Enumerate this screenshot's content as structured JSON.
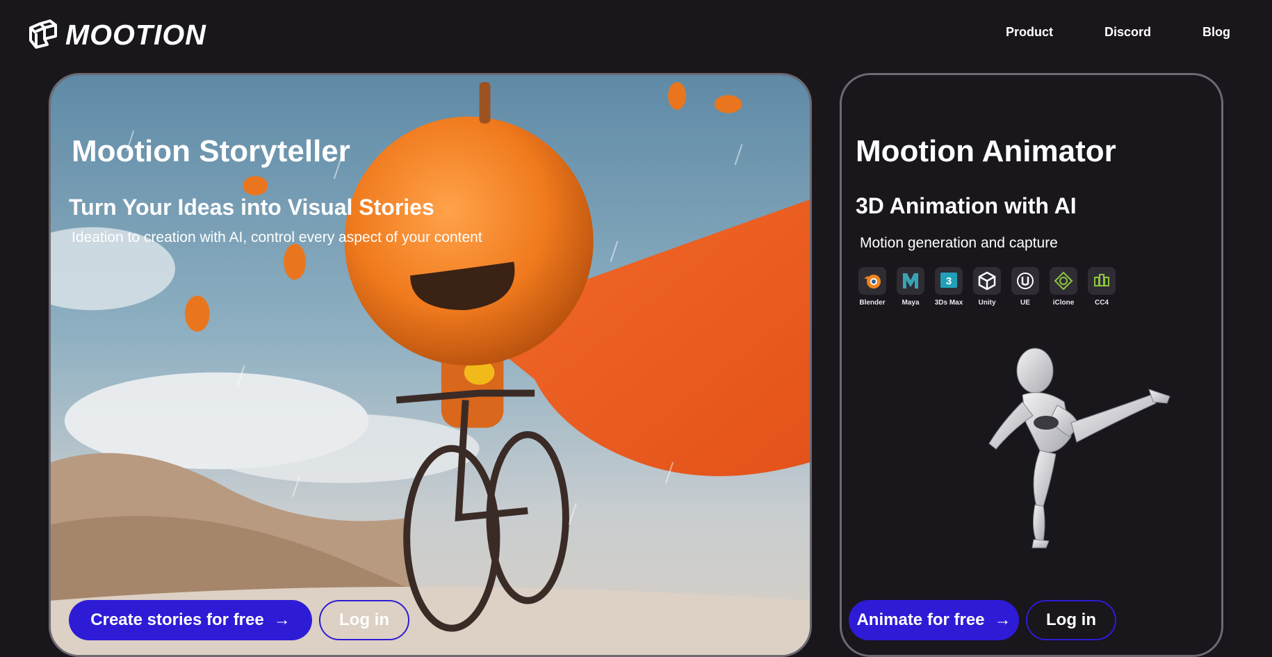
{
  "brand": {
    "name": "MOOTION"
  },
  "nav": {
    "items": [
      "Product",
      "Discord",
      "Blog"
    ]
  },
  "storyteller": {
    "title": "Mootion Storyteller",
    "subtitle": "Turn Your Ideas into Visual Stories",
    "description": "Ideation to creation with AI, control every aspect of your content",
    "cta_label": "Create stories for free",
    "login_label": "Log in"
  },
  "animator": {
    "title": "Mootion Animator",
    "subtitle": "3D Animation with AI",
    "description": "Motion generation and capture",
    "tools": [
      {
        "label": "Blender",
        "icon": "blender-icon"
      },
      {
        "label": "Maya",
        "icon": "maya-icon"
      },
      {
        "label": "3Ds Max",
        "icon": "3ds-max-icon"
      },
      {
        "label": "Unity",
        "icon": "unity-icon"
      },
      {
        "label": "UE",
        "icon": "unreal-engine-icon"
      },
      {
        "label": "iClone",
        "icon": "iclone-icon"
      },
      {
        "label": "CC4",
        "icon": "character-creator-icon"
      }
    ],
    "cta_label": "Animate for free",
    "login_label": "Log in"
  },
  "colors": {
    "background": "#19161c",
    "accent": "#2e1bd6",
    "card_border": "#6d6a72"
  }
}
